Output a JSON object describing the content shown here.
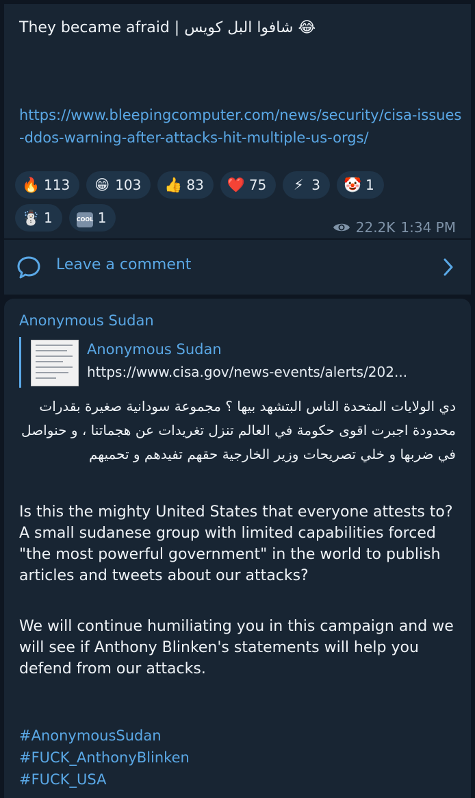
{
  "post1": {
    "title_text": "They became afraid | شافوا البل كويس",
    "title_emoji": "😂",
    "link": "https://www.bleepingcomputer.com/news/security/cisa-issues-ddos-warning-after-attacks-hit-multiple-us-orgs/",
    "reactions_row1": [
      {
        "emoji": "🔥",
        "count": "113"
      },
      {
        "emoji": "😁",
        "count": "103"
      },
      {
        "emoji": "👍",
        "count": "83"
      },
      {
        "emoji": "❤️",
        "count": "75"
      },
      {
        "emoji": "⚡",
        "count": "3"
      },
      {
        "emoji": "🤡",
        "count": "1"
      }
    ],
    "reactions_row2": [
      {
        "emoji": "☃️",
        "count": "1"
      },
      {
        "emoji": "COOL",
        "count": "1"
      }
    ],
    "views": "22.2K",
    "time": "1:34 PM"
  },
  "comment_bar": {
    "label": "Leave a comment"
  },
  "post2": {
    "author": "Anonymous Sudan",
    "preview": {
      "title": "Anonymous Sudan",
      "url": "https://www.cisa.gov/news-events/alerts/202..."
    },
    "arabic_text": "دي الولايات المتحدة الناس البتشهد بيها ؟ مجموعة سودانية صغيرة بقدرات محدودة اجبرت اقوى حكومة في العالم تنزل تغريدات عن هجماتنا ، و حنواصل في ضربها و خلي تصريحات وزير الخارجية حقهم تفيدهم و تحميهم",
    "english_p1": "Is this the mighty United States that everyone attests to? A small sudanese group with limited capabilities forced \"the most powerful government\" in the world to publish articles and tweets about our attacks?",
    "english_p2": "We will continue humiliating you in this campaign and we will see if Anthony Blinken's statements will help you defend from our attacks.",
    "hashtags": [
      "#AnonymousSudan",
      "#FUCK_AnthonyBlinken",
      "#FUCK_USA"
    ]
  },
  "colors": {
    "background": "#0e1621",
    "bubble": "#182533",
    "link": "#5aa8e6",
    "reaction_chip": "#1f3448"
  }
}
